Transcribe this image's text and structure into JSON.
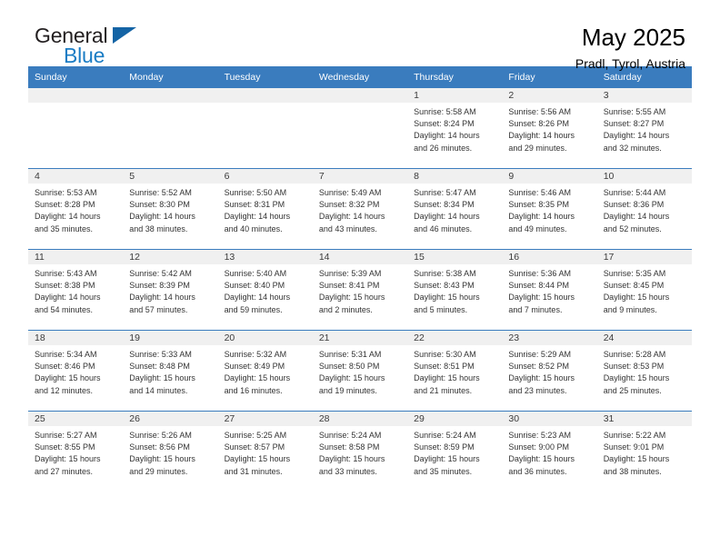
{
  "brand": {
    "name_part1": "General",
    "name_part2": "Blue",
    "flag_icon": "triangle-flag-icon"
  },
  "header": {
    "title": "May 2025",
    "subtitle": "Pradl, Tyrol, Austria"
  },
  "colors": {
    "header_blue": "#3a7cbe",
    "brand_blue": "#1a7cc4",
    "daynum_band": "#f0f0f0",
    "text": "#333333"
  },
  "weekday_headers": [
    "Sunday",
    "Monday",
    "Tuesday",
    "Wednesday",
    "Thursday",
    "Friday",
    "Saturday"
  ],
  "weeks": [
    [
      {
        "empty": true
      },
      {
        "empty": true
      },
      {
        "empty": true
      },
      {
        "empty": true
      },
      {
        "day": "1",
        "sunrise": "Sunrise: 5:58 AM",
        "sunset": "Sunset: 8:24 PM",
        "daylight1": "Daylight: 14 hours",
        "daylight2": "and 26 minutes."
      },
      {
        "day": "2",
        "sunrise": "Sunrise: 5:56 AM",
        "sunset": "Sunset: 8:26 PM",
        "daylight1": "Daylight: 14 hours",
        "daylight2": "and 29 minutes."
      },
      {
        "day": "3",
        "sunrise": "Sunrise: 5:55 AM",
        "sunset": "Sunset: 8:27 PM",
        "daylight1": "Daylight: 14 hours",
        "daylight2": "and 32 minutes."
      }
    ],
    [
      {
        "day": "4",
        "sunrise": "Sunrise: 5:53 AM",
        "sunset": "Sunset: 8:28 PM",
        "daylight1": "Daylight: 14 hours",
        "daylight2": "and 35 minutes."
      },
      {
        "day": "5",
        "sunrise": "Sunrise: 5:52 AM",
        "sunset": "Sunset: 8:30 PM",
        "daylight1": "Daylight: 14 hours",
        "daylight2": "and 38 minutes."
      },
      {
        "day": "6",
        "sunrise": "Sunrise: 5:50 AM",
        "sunset": "Sunset: 8:31 PM",
        "daylight1": "Daylight: 14 hours",
        "daylight2": "and 40 minutes."
      },
      {
        "day": "7",
        "sunrise": "Sunrise: 5:49 AM",
        "sunset": "Sunset: 8:32 PM",
        "daylight1": "Daylight: 14 hours",
        "daylight2": "and 43 minutes."
      },
      {
        "day": "8",
        "sunrise": "Sunrise: 5:47 AM",
        "sunset": "Sunset: 8:34 PM",
        "daylight1": "Daylight: 14 hours",
        "daylight2": "and 46 minutes."
      },
      {
        "day": "9",
        "sunrise": "Sunrise: 5:46 AM",
        "sunset": "Sunset: 8:35 PM",
        "daylight1": "Daylight: 14 hours",
        "daylight2": "and 49 minutes."
      },
      {
        "day": "10",
        "sunrise": "Sunrise: 5:44 AM",
        "sunset": "Sunset: 8:36 PM",
        "daylight1": "Daylight: 14 hours",
        "daylight2": "and 52 minutes."
      }
    ],
    [
      {
        "day": "11",
        "sunrise": "Sunrise: 5:43 AM",
        "sunset": "Sunset: 8:38 PM",
        "daylight1": "Daylight: 14 hours",
        "daylight2": "and 54 minutes."
      },
      {
        "day": "12",
        "sunrise": "Sunrise: 5:42 AM",
        "sunset": "Sunset: 8:39 PM",
        "daylight1": "Daylight: 14 hours",
        "daylight2": "and 57 minutes."
      },
      {
        "day": "13",
        "sunrise": "Sunrise: 5:40 AM",
        "sunset": "Sunset: 8:40 PM",
        "daylight1": "Daylight: 14 hours",
        "daylight2": "and 59 minutes."
      },
      {
        "day": "14",
        "sunrise": "Sunrise: 5:39 AM",
        "sunset": "Sunset: 8:41 PM",
        "daylight1": "Daylight: 15 hours",
        "daylight2": "and 2 minutes."
      },
      {
        "day": "15",
        "sunrise": "Sunrise: 5:38 AM",
        "sunset": "Sunset: 8:43 PM",
        "daylight1": "Daylight: 15 hours",
        "daylight2": "and 5 minutes."
      },
      {
        "day": "16",
        "sunrise": "Sunrise: 5:36 AM",
        "sunset": "Sunset: 8:44 PM",
        "daylight1": "Daylight: 15 hours",
        "daylight2": "and 7 minutes."
      },
      {
        "day": "17",
        "sunrise": "Sunrise: 5:35 AM",
        "sunset": "Sunset: 8:45 PM",
        "daylight1": "Daylight: 15 hours",
        "daylight2": "and 9 minutes."
      }
    ],
    [
      {
        "day": "18",
        "sunrise": "Sunrise: 5:34 AM",
        "sunset": "Sunset: 8:46 PM",
        "daylight1": "Daylight: 15 hours",
        "daylight2": "and 12 minutes."
      },
      {
        "day": "19",
        "sunrise": "Sunrise: 5:33 AM",
        "sunset": "Sunset: 8:48 PM",
        "daylight1": "Daylight: 15 hours",
        "daylight2": "and 14 minutes."
      },
      {
        "day": "20",
        "sunrise": "Sunrise: 5:32 AM",
        "sunset": "Sunset: 8:49 PM",
        "daylight1": "Daylight: 15 hours",
        "daylight2": "and 16 minutes."
      },
      {
        "day": "21",
        "sunrise": "Sunrise: 5:31 AM",
        "sunset": "Sunset: 8:50 PM",
        "daylight1": "Daylight: 15 hours",
        "daylight2": "and 19 minutes."
      },
      {
        "day": "22",
        "sunrise": "Sunrise: 5:30 AM",
        "sunset": "Sunset: 8:51 PM",
        "daylight1": "Daylight: 15 hours",
        "daylight2": "and 21 minutes."
      },
      {
        "day": "23",
        "sunrise": "Sunrise: 5:29 AM",
        "sunset": "Sunset: 8:52 PM",
        "daylight1": "Daylight: 15 hours",
        "daylight2": "and 23 minutes."
      },
      {
        "day": "24",
        "sunrise": "Sunrise: 5:28 AM",
        "sunset": "Sunset: 8:53 PM",
        "daylight1": "Daylight: 15 hours",
        "daylight2": "and 25 minutes."
      }
    ],
    [
      {
        "day": "25",
        "sunrise": "Sunrise: 5:27 AM",
        "sunset": "Sunset: 8:55 PM",
        "daylight1": "Daylight: 15 hours",
        "daylight2": "and 27 minutes."
      },
      {
        "day": "26",
        "sunrise": "Sunrise: 5:26 AM",
        "sunset": "Sunset: 8:56 PM",
        "daylight1": "Daylight: 15 hours",
        "daylight2": "and 29 minutes."
      },
      {
        "day": "27",
        "sunrise": "Sunrise: 5:25 AM",
        "sunset": "Sunset: 8:57 PM",
        "daylight1": "Daylight: 15 hours",
        "daylight2": "and 31 minutes."
      },
      {
        "day": "28",
        "sunrise": "Sunrise: 5:24 AM",
        "sunset": "Sunset: 8:58 PM",
        "daylight1": "Daylight: 15 hours",
        "daylight2": "and 33 minutes."
      },
      {
        "day": "29",
        "sunrise": "Sunrise: 5:24 AM",
        "sunset": "Sunset: 8:59 PM",
        "daylight1": "Daylight: 15 hours",
        "daylight2": "and 35 minutes."
      },
      {
        "day": "30",
        "sunrise": "Sunrise: 5:23 AM",
        "sunset": "Sunset: 9:00 PM",
        "daylight1": "Daylight: 15 hours",
        "daylight2": "and 36 minutes."
      },
      {
        "day": "31",
        "sunrise": "Sunrise: 5:22 AM",
        "sunset": "Sunset: 9:01 PM",
        "daylight1": "Daylight: 15 hours",
        "daylight2": "and 38 minutes."
      }
    ]
  ]
}
